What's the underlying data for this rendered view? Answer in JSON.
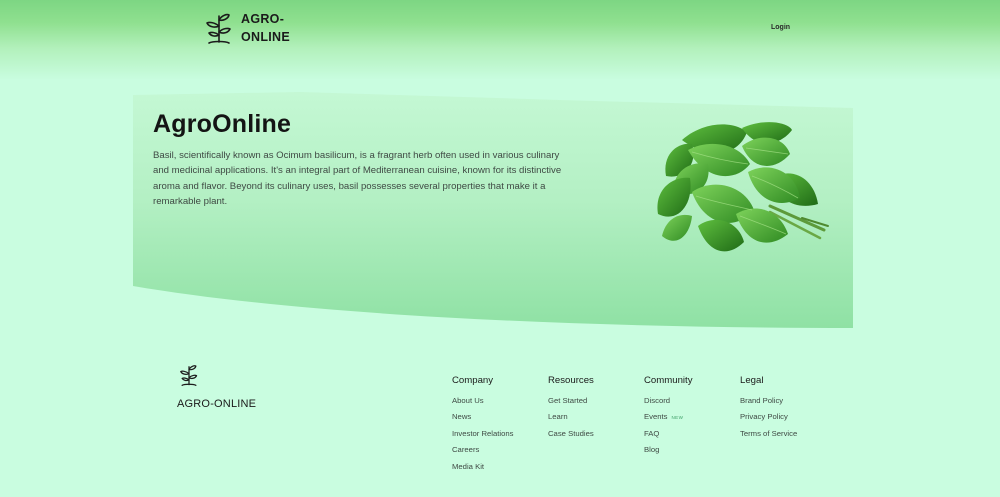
{
  "header": {
    "brand_line1": "AGRO-",
    "brand_line2": "ONLINE",
    "login_label": "Login"
  },
  "hero": {
    "title": "AgroOnline",
    "description": "Basil, scientifically known as Ocimum basilicum, is a fragrant herb often used in various culinary and medicinal applications. It's an integral part of Mediterranean cuisine, known for its distinctive aroma and flavor. Beyond its culinary uses, basil possesses several properties that make it a remarkable plant."
  },
  "footer": {
    "brand": "AGRO-ONLINE",
    "columns": [
      {
        "title": "Company",
        "links": [
          "About Us",
          "News",
          "Investor Relations",
          "Careers",
          "Media Kit"
        ]
      },
      {
        "title": "Resources",
        "links": [
          "Get Started",
          "Learn",
          "Case Studies"
        ]
      },
      {
        "title": "Community",
        "links": [
          "Discord",
          "Events",
          "FAQ",
          "Blog"
        ],
        "badge": "NEW"
      },
      {
        "title": "Legal",
        "links": [
          "Brand Policy",
          "Privacy Policy",
          "Terms of Service"
        ]
      }
    ]
  },
  "colors": {
    "page_background": "#c9fde0",
    "header_green": "#7dd683",
    "hero_panel_top": "#b8f3c8",
    "hero_panel_bottom": "#8fe1a4",
    "leaf_green": "#3c9a2f"
  },
  "icons": {
    "logo": "sprout-icon",
    "hero_image": "basil-leaves-image"
  }
}
